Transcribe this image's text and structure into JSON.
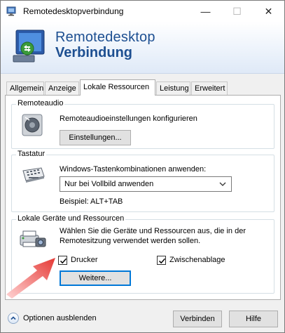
{
  "window": {
    "title": "Remotedesktopverbindung",
    "minimize_glyph": "—",
    "maximize_glyph": "☐",
    "close_glyph": "✕"
  },
  "banner": {
    "line1": "Remotedesktop",
    "line2": "Verbindung"
  },
  "tabs": [
    {
      "label": "Allgemein",
      "active": false
    },
    {
      "label": "Anzeige",
      "active": false
    },
    {
      "label": "Lokale Ressourcen",
      "active": true
    },
    {
      "label": "Leistung",
      "active": false
    },
    {
      "label": "Erweitert",
      "active": false
    }
  ],
  "remoteaudio": {
    "group_label": "Remoteaudio",
    "description": "Remoteaudioeinstellungen konfigurieren",
    "settings_button": "Einstellungen..."
  },
  "keyboard": {
    "group_label": "Tastatur",
    "description": "Windows-Tastenkombinationen anwenden:",
    "selected_option": "Nur bei Vollbild anwenden",
    "example": "Beispiel: ALT+TAB"
  },
  "local_devices": {
    "group_label": "Lokale Geräte und Ressourcen",
    "description_line1": "Wählen Sie die Geräte und Ressourcen aus, die in der",
    "description_line2": "Remotesitzung verwendet werden sollen.",
    "printer_label": "Drucker",
    "printer_checked": true,
    "clipboard_label": "Zwischenablage",
    "clipboard_checked": true,
    "more_button": "Weitere..."
  },
  "footer": {
    "options_label": "Optionen ausblenden",
    "connect_button": "Verbinden",
    "help_button": "Hilfe"
  },
  "colors": {
    "banner_text": "#1d4f91",
    "focus_border": "#0078d7",
    "annotation_arrow": "#e53935"
  }
}
